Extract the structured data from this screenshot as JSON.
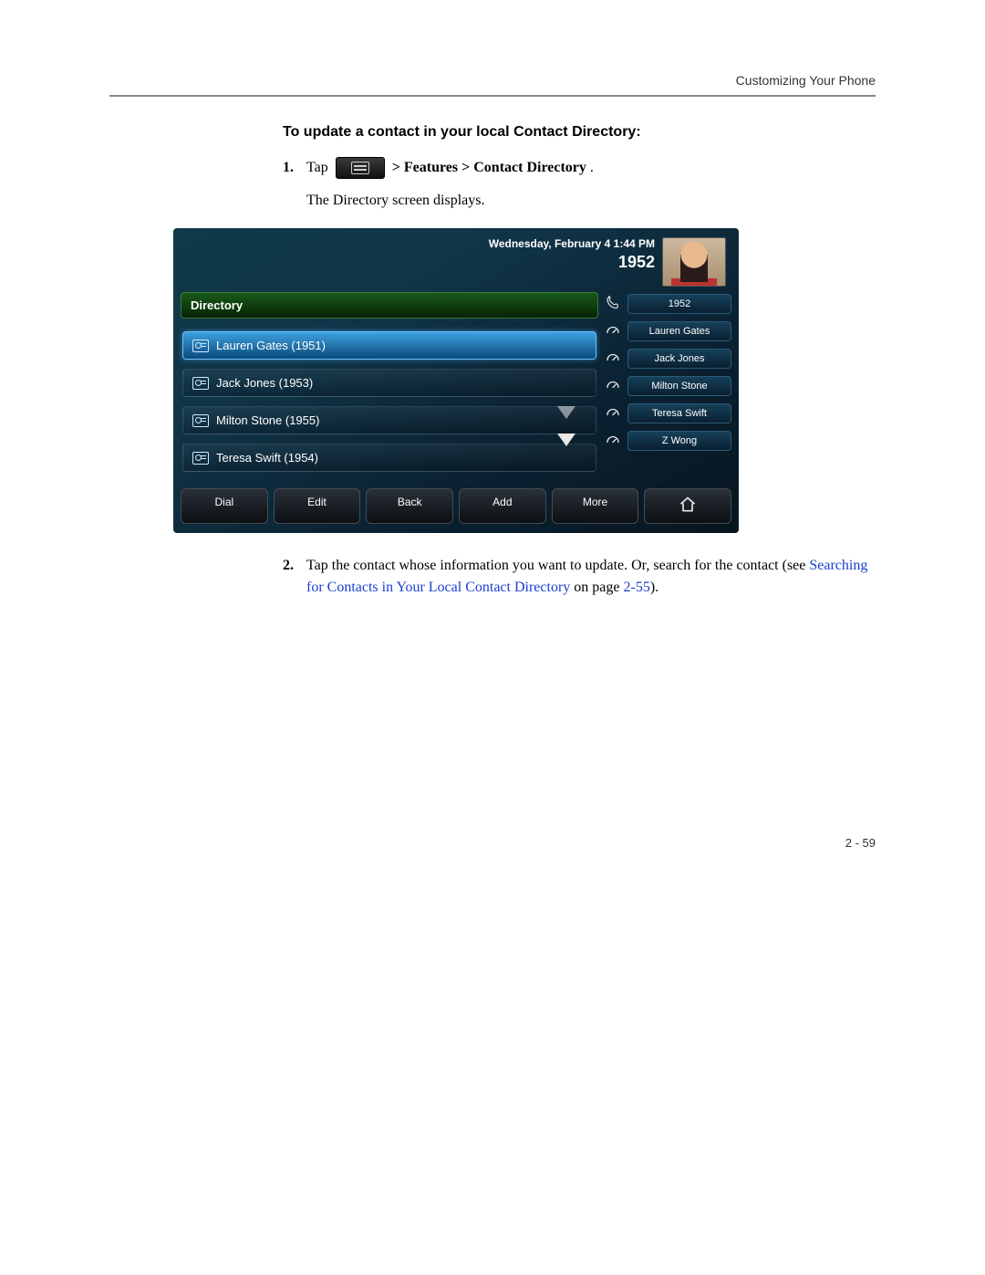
{
  "header": {
    "running_head": "Customizing Your Phone"
  },
  "section": {
    "heading": "To update a contact in your local Contact Directory:"
  },
  "steps": {
    "s1": {
      "num": "1.",
      "pre": "Tap",
      "post": "> Features > Contact Directory",
      "period": ".",
      "result": "The Directory screen displays."
    },
    "s2": {
      "num": "2.",
      "pre": "Tap the contact whose information you want to update. Or, search for the contact (see ",
      "link": "Searching for Contacts in Your Local Contact Directory",
      "mid": " on page ",
      "pageref": "2-55",
      "post": ")."
    }
  },
  "phone": {
    "date": "Wednesday, February 4  1:44 PM",
    "extension": "1952",
    "directory_label": "Directory",
    "contacts": [
      {
        "label": "Lauren Gates (1951)",
        "selected": true
      },
      {
        "label": "Jack Jones (1953)",
        "selected": false
      },
      {
        "label": "Milton Stone (1955)",
        "selected": false
      },
      {
        "label": "Teresa Swift (1954)",
        "selected": false
      }
    ],
    "speeddial": [
      {
        "label": "1952",
        "icon": "handset"
      },
      {
        "label": "Lauren Gates",
        "icon": "speed"
      },
      {
        "label": "Jack Jones",
        "icon": "speed"
      },
      {
        "label": "Milton Stone",
        "icon": "speed"
      },
      {
        "label": "Teresa Swift",
        "icon": "speed"
      },
      {
        "label": "Z Wong",
        "icon": "speed"
      }
    ],
    "softkeys": {
      "dial": "Dial",
      "edit": "Edit",
      "back": "Back",
      "add": "Add",
      "more": "More"
    }
  },
  "footer": {
    "page": "2 - 59"
  }
}
